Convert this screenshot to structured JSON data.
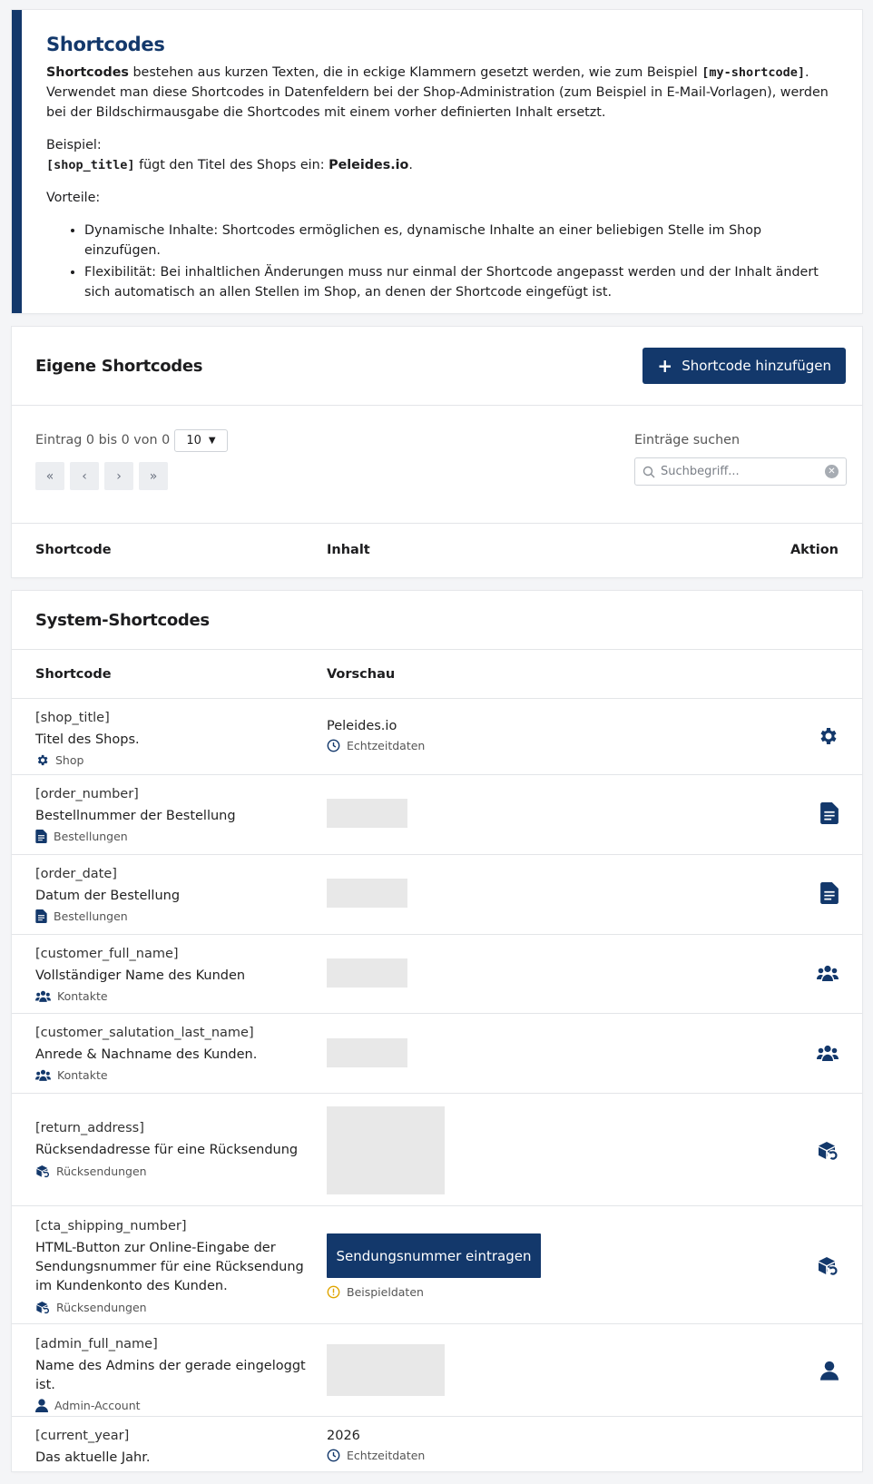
{
  "info": {
    "title": "Shortcodes",
    "intro_bold": "Shortcodes",
    "intro_text1": " bestehen aus kurzen Texten, die in eckige Klammern gesetzt werden, wie zum Beispiel ",
    "intro_example": "[my-shortcode]",
    "intro_text2": ". Verwendet man diese Shortcodes in Datenfeldern bei der Shop-Administration (zum Beispiel in E-Mail-Vorlagen), werden bei der Bildschirmausgabe die Shortcodes mit einem vorher definierten Inhalt ersetzt.",
    "example_label": "Beispiel:",
    "example_code": "[shop_title]",
    "example_text": " fügt den Titel des Shops ein: ",
    "example_value": "Peleides.io",
    "example_end": ".",
    "advantages_label": "Vorteile:",
    "advantages": [
      "Dynamische Inhalte: Shortcodes ermöglichen es, dynamische Inhalte an einer beliebigen Stelle im Shop einzufügen.",
      "Flexibilität: Bei inhaltlichen Änderungen muss nur einmal der Shortcode angepasst werden und der Inhalt ändert sich automatisch an allen Stellen im Shop, an denen der Shortcode eingefügt ist."
    ]
  },
  "own": {
    "title": "Eigene Shortcodes",
    "add_button": "Shortcode hinzufügen",
    "entries_info": "Eintrag 0 bis 0 von 0",
    "page_size": "10",
    "pager": [
      "«",
      "‹",
      "›",
      "»"
    ],
    "search_label": "Einträge suchen",
    "search_placeholder": "Suchbegriff...",
    "columns": {
      "shortcode": "Shortcode",
      "content": "Inhalt",
      "action": "Aktion"
    }
  },
  "system": {
    "title": "System-Shortcodes",
    "columns": {
      "shortcode": "Shortcode",
      "preview": "Vorschau"
    },
    "rows": [
      {
        "code": "[shop_title]",
        "desc": "Titel des Shops.",
        "category": "Shop",
        "cat_icon": "gear-icon",
        "preview_text": "Peleides.io",
        "preview_note": "Echtzeitdaten",
        "note_icon": "clock-icon"
      },
      {
        "code": "[order_number]",
        "desc": "Bestellnummer der Bestellung",
        "category": "Bestellungen",
        "cat_icon": "document-icon"
      },
      {
        "code": "[order_date]",
        "desc": "Datum der Bestellung",
        "category": "Bestellungen",
        "cat_icon": "document-icon"
      },
      {
        "code": "[customer_full_name]",
        "desc": "Vollständiger Name des Kunden",
        "category": "Kontakte",
        "cat_icon": "users-icon"
      },
      {
        "code": "[customer_salutation_last_name]",
        "desc": "Anrede & Nachname des Kunden.",
        "category": "Kontakte",
        "cat_icon": "users-icon"
      },
      {
        "code": "[return_address]",
        "desc": "Rücksendadresse für eine Rücksendung",
        "category": "Rücksendungen",
        "cat_icon": "return-box-icon"
      },
      {
        "code": "[cta_shipping_number]",
        "desc": "HTML-Button zur Online-Eingabe der Sendungsnummer für eine Rücksendung im Kundenkonto des Kunden.",
        "category": "Rücksendungen",
        "cat_icon": "return-box-icon",
        "preview_button": "Sendungsnummer eintragen",
        "preview_note": "Beispieldaten",
        "note_icon": "warning-icon"
      },
      {
        "code": "[admin_full_name]",
        "desc": "Name des Admins der gerade eingeloggt ist.",
        "category": "Admin-Account",
        "cat_icon": "user-icon"
      },
      {
        "code": "[current_year]",
        "desc": "Das aktuelle Jahr.",
        "preview_text": "2026",
        "preview_note": "Echtzeitdaten",
        "note_icon": "clock-icon"
      }
    ]
  },
  "colors": {
    "primary": "#13386b",
    "warning": "#e0a500",
    "placeholder": "#e8e8e8"
  }
}
